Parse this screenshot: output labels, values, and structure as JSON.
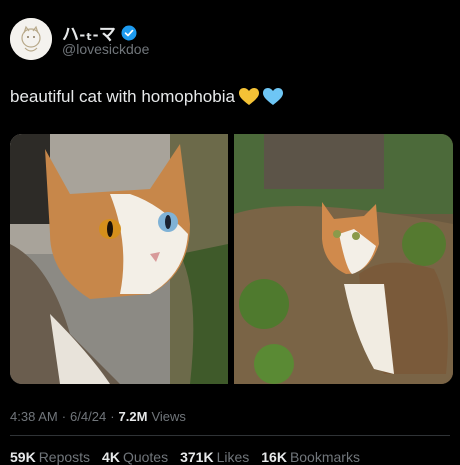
{
  "post": {
    "display_name": "ハ-ₜ-マ",
    "handle": "@lovesickdoe",
    "text": "beautiful cat with homophobia",
    "hearts": [
      "yellow-heart",
      "blue-heart"
    ],
    "colors": {
      "yellow_heart": "#f4c236",
      "blue_heart": "#6ec6f5",
      "verified": "#1d9bf0"
    },
    "images": [
      {
        "description_icon": "cat-closeup-photo"
      },
      {
        "description_icon": "cat-garden-photo"
      }
    ],
    "time": "4:38 AM",
    "date": "6/4/24",
    "views_count": "7.2M",
    "views_label": "Views",
    "stats": [
      {
        "count": "59K",
        "label": "Reposts"
      },
      {
        "count": "4K",
        "label": "Quotes"
      },
      {
        "count": "371K",
        "label": "Likes"
      },
      {
        "count": "16K",
        "label": "Bookmarks"
      }
    ]
  }
}
